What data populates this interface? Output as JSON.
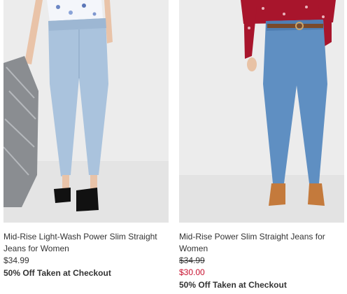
{
  "products": [
    {
      "title": "Mid-Rise Light-Wash Power Slim Straight Jeans for Women",
      "price": "$34.99",
      "promo": "50% Off Taken at Checkout"
    },
    {
      "title": "Mid-Rise Power Slim Straight Jeans for Women",
      "original_price": "$34.99",
      "sale_price": "$30.00",
      "promo": "50% Off Taken at Checkout"
    }
  ],
  "colors": {
    "sale_red": "#c8102e",
    "text": "#333333"
  }
}
